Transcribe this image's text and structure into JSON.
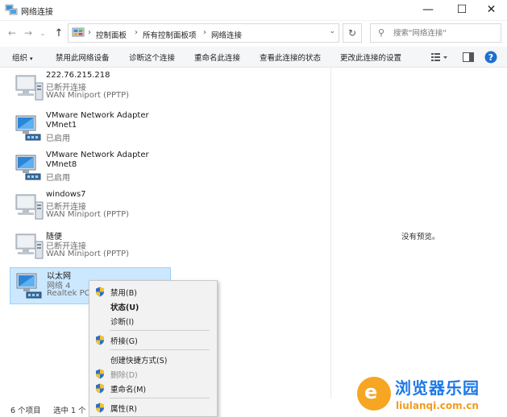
{
  "window": {
    "title": "网络连接",
    "minimize_glyph": "—",
    "maximize_glyph": "☐",
    "close_glyph": "✕"
  },
  "nav": {
    "back_glyph": "←",
    "forward_glyph": "→",
    "recent_glyph": "⌄",
    "up_glyph": "↑",
    "refresh_glyph": "↻",
    "crumbs": [
      "控制面板",
      "所有控制面板项",
      "网络连接"
    ],
    "crumb_separator": "›",
    "dropdown_glyph": "⌄",
    "search_placeholder": "搜索\"网络连接\"",
    "search_glyph": "⚲"
  },
  "toolbar": {
    "organize": "组织",
    "organize_caret": "▾",
    "items": [
      "禁用此网络设备",
      "诊断这个连接",
      "重命名此连接",
      "查看此连接的状态",
      "更改此连接的设置"
    ],
    "help_glyph": "?"
  },
  "connections": [
    {
      "name": "222.76.215.218",
      "status": "已断开连接",
      "device": "WAN Miniport (PPTP)",
      "kind": "wan"
    },
    {
      "name": "VMware Network Adapter",
      "status": "VMnet1",
      "device": "已启用",
      "kind": "lan"
    },
    {
      "name": "VMware Network Adapter",
      "status": "VMnet8",
      "device": "已启用",
      "kind": "lan"
    },
    {
      "name": "windows7",
      "status": "已断开连接",
      "device": "WAN Miniport (PPTP)",
      "kind": "wan"
    },
    {
      "name": "随便",
      "status": "已断开连接",
      "device": "WAN Miniport (PPTP)",
      "kind": "wan"
    },
    {
      "name": "以太网",
      "status": "网络 4",
      "device": "Realtek PCI",
      "kind": "lan",
      "selected": true
    }
  ],
  "preview": {
    "message": "没有预览。"
  },
  "context_menu": {
    "items": [
      {
        "label": "禁用(B)",
        "shield": true,
        "bold": false,
        "disabled": false
      },
      {
        "label": "状态(U)",
        "shield": false,
        "bold": true,
        "disabled": false
      },
      {
        "label": "诊断(I)",
        "shield": false,
        "bold": false,
        "disabled": false
      },
      {
        "label": "桥接(G)",
        "shield": true,
        "bold": false,
        "disabled": false
      },
      {
        "label": "创建快捷方式(S)",
        "shield": false,
        "bold": false,
        "disabled": false
      },
      {
        "label": "删除(D)",
        "shield": true,
        "bold": false,
        "disabled": true
      },
      {
        "label": "重命名(M)",
        "shield": true,
        "bold": false,
        "disabled": false
      },
      {
        "label": "属性(R)",
        "shield": true,
        "bold": false,
        "disabled": false
      }
    ]
  },
  "statusbar": {
    "count": "6 个项目",
    "selected": "选中 1 个"
  },
  "watermark": {
    "title": "浏览器乐园",
    "url": "liulanqi.com.cn",
    "logo_letter": "e"
  },
  "colors": {
    "selection": "#cce8ff",
    "selection_border": "#99d1ff",
    "watermark_blue": "#1e78e6",
    "watermark_orange": "#f6a623"
  }
}
